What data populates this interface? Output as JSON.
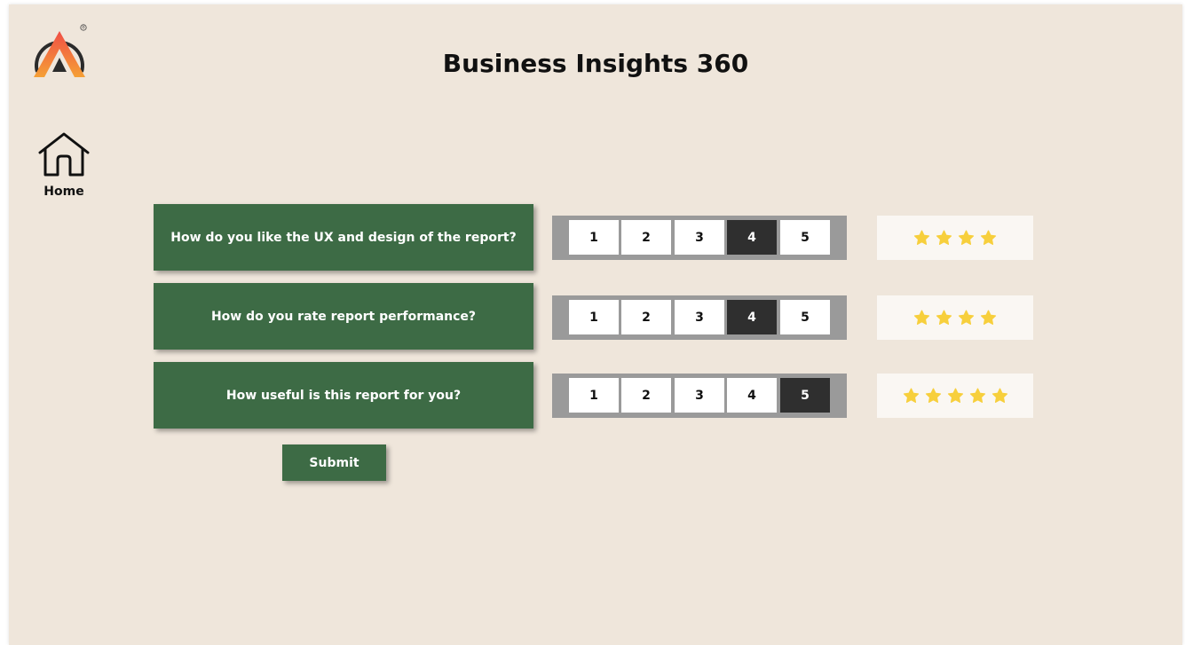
{
  "header": {
    "title": "Business Insights 360",
    "logo_icon": "brand-logo-a-icon",
    "logo_mark": "®",
    "colors": {
      "logo_gradient_top": "#f04e45",
      "logo_gradient_bottom": "#f5a036",
      "logo_inner": "#2b2b2b"
    }
  },
  "nav": {
    "home_label": "Home",
    "home_icon": "house-icon"
  },
  "colors": {
    "background": "#efe6db",
    "question_bg": "#3d6b45",
    "scale_bg": "#9a9a9a",
    "selected_option": "#2f2f2f",
    "star": "#f7cf3c"
  },
  "questions": [
    {
      "text": "How do you like the UX and design of the report?",
      "options": [
        "1",
        "2",
        "3",
        "4",
        "5"
      ],
      "selected": 4,
      "stars": 4
    },
    {
      "text": "How do you rate report performance?",
      "options": [
        "1",
        "2",
        "3",
        "4",
        "5"
      ],
      "selected": 4,
      "stars": 4
    },
    {
      "text": "How useful is this report for you?",
      "options": [
        "1",
        "2",
        "3",
        "4",
        "5"
      ],
      "selected": 5,
      "stars": 5
    }
  ],
  "submit_label": "Submit"
}
